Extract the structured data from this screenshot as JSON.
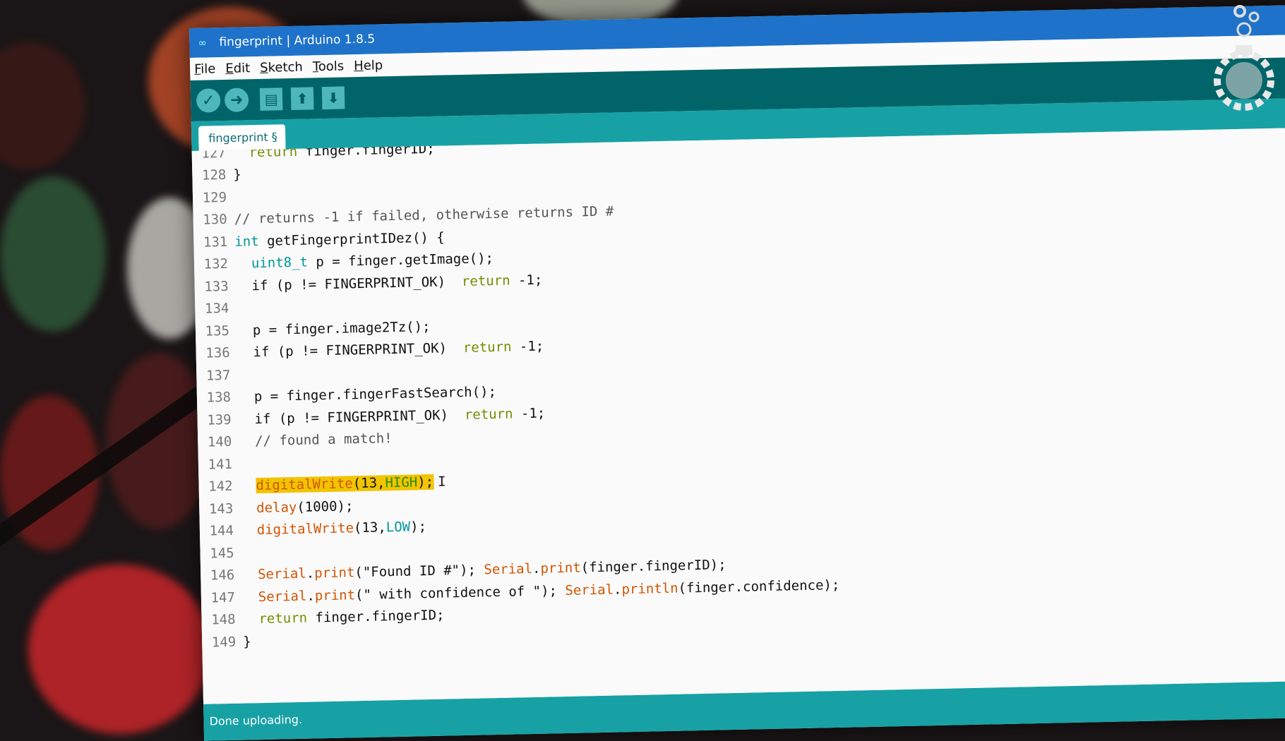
{
  "window": {
    "title": "fingerprint | Arduino 1.8.5"
  },
  "menu": [
    "File",
    "Edit",
    "Sketch",
    "Tools",
    "Help"
  ],
  "toolbar": {
    "verify_icon": "check-icon",
    "upload_icon": "arrow-right-icon",
    "new_icon": "document-icon",
    "open_icon": "arrow-up-icon",
    "save_icon": "arrow-down-icon"
  },
  "tab": {
    "label": "fingerprint §"
  },
  "code": {
    "lines": [
      {
        "n": "127",
        "t": "  return finger.fingerID;"
      },
      {
        "n": "128",
        "t": "}"
      },
      {
        "n": "129",
        "t": ""
      },
      {
        "n": "130",
        "t": "// returns -1 if failed, otherwise returns ID #"
      },
      {
        "n": "131",
        "t": "int getFingerprintIDez() {"
      },
      {
        "n": "132",
        "t": "  uint8_t p = finger.getImage();"
      },
      {
        "n": "133",
        "t": "  if (p != FINGERPRINT_OK)  return -1;"
      },
      {
        "n": "134",
        "t": ""
      },
      {
        "n": "135",
        "t": "  p = finger.image2Tz();"
      },
      {
        "n": "136",
        "t": "  if (p != FINGERPRINT_OK)  return -1;"
      },
      {
        "n": "137",
        "t": ""
      },
      {
        "n": "138",
        "t": "  p = finger.fingerFastSearch();"
      },
      {
        "n": "139",
        "t": "  if (p != FINGERPRINT_OK)  return -1;"
      },
      {
        "n": "140",
        "t": "  // found a match!"
      },
      {
        "n": "141",
        "t": ""
      },
      {
        "n": "142",
        "t": "  digitalWrite(13,HIGH);"
      },
      {
        "n": "143",
        "t": "  delay(1000);"
      },
      {
        "n": "144",
        "t": "  digitalWrite(13,LOW);"
      },
      {
        "n": "145",
        "t": ""
      },
      {
        "n": "146",
        "t": "  Serial.print(\"Found ID #\"); Serial.print(finger.fingerID);"
      },
      {
        "n": "147",
        "t": "  Serial.print(\" with confidence of \"); Serial.println(finger.confidence);"
      },
      {
        "n": "148",
        "t": "  return finger.fingerID;"
      },
      {
        "n": "149",
        "t": "}"
      }
    ]
  },
  "status": {
    "text": "Done uploading."
  },
  "colors": {
    "title_bar": "#1e72c9",
    "toolbar": "#006468",
    "tab_bar": "#17a1a5",
    "highlight": "#f1c400"
  }
}
